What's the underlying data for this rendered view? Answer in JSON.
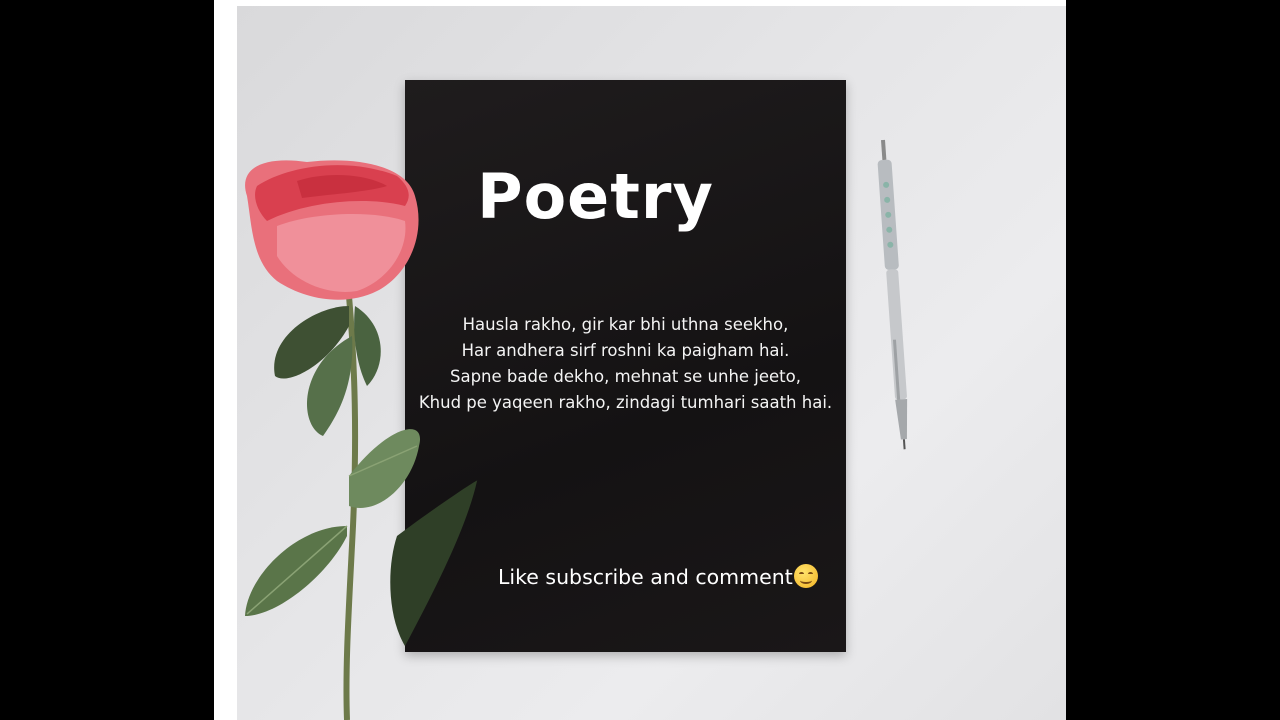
{
  "poster": {
    "title": "Poetry",
    "poem_lines": [
      "Hausla rakho, gir kar bhi uthna seekho,",
      "Har andhera sirf roshni ka paigham hai.",
      "Sapne bade dekho, mehnat se unhe jeeto,",
      "Khud pe yaqeen rakho, zindagi tumhari saath hai."
    ],
    "cta": "Like subscribe and comment",
    "emoji_icon": "smiling-face-icon"
  },
  "colors": {
    "background": "#000000",
    "photo_surface": "#e4e4e6",
    "paper": "#1a1718",
    "text": "#ffffff",
    "rose": "#e84c5e"
  }
}
